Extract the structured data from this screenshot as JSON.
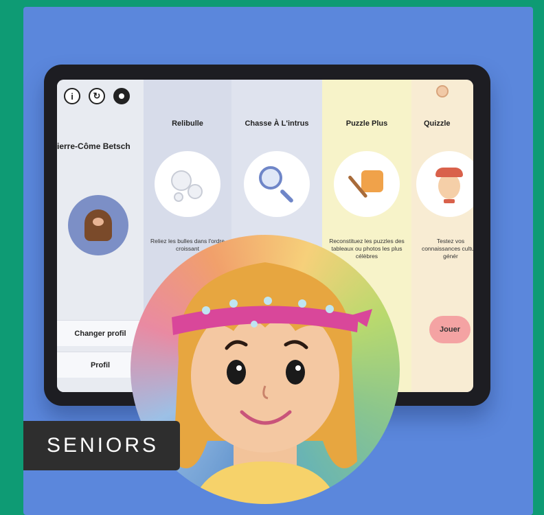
{
  "app": {
    "user_name": "Pierre-Côme Betsch",
    "side_buttons": {
      "change_profile": "Changer profil",
      "profile": "Profil"
    }
  },
  "games": [
    {
      "title": "Relibulle",
      "description": "Reliez les bulles dans l'ordre croissant",
      "icon": "bubbles-icon"
    },
    {
      "title": "Chasse À L'intrus",
      "description": "",
      "icon": "magnifier-icon"
    },
    {
      "title": "Puzzle Plus",
      "description": "Reconstituez les puzzles des tableaux ou photos les plus célèbres",
      "icon": "puzzle-brush-icon"
    },
    {
      "title": "Quizzle",
      "description": "Testez vos connaissances culture génér",
      "icon": "quiz-character-icon",
      "play_label": "Jouer"
    }
  ],
  "badge": {
    "label": "SENIORS"
  },
  "colors": {
    "page_background": "#0e9b74",
    "card_background": "#5b87dc",
    "badge_background": "#2e2e2e",
    "column_colors": [
      "#d7dcea",
      "#dfe3ee",
      "#f7f3c9",
      "#f8ecd3"
    ]
  }
}
